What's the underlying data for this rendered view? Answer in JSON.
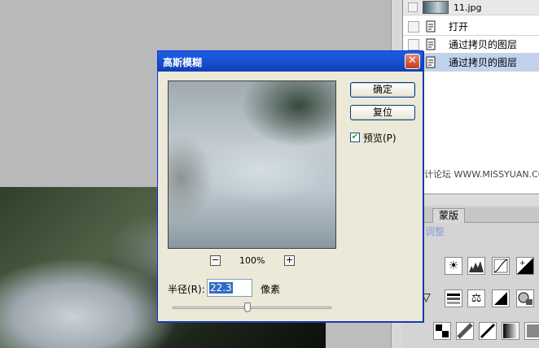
{
  "dialog": {
    "title": "高斯模糊",
    "close_label": "✕",
    "ok_label": "确定",
    "reset_label": "复位",
    "preview_checked": true,
    "preview_label": "预览(P)",
    "zoom_minus": "−",
    "zoom_level": "100%",
    "zoom_plus": "+",
    "radius_label": "半径(R):",
    "radius_value": "22.3",
    "radius_unit": "像素"
  },
  "history": {
    "snapshot_label": "11.jpg",
    "items": [
      {
        "label": "打开",
        "selected": false
      },
      {
        "label": "通过拷贝的图层",
        "selected": false
      },
      {
        "label": "通过拷贝的图层",
        "selected": true
      }
    ]
  },
  "adjustments": {
    "tab_label": "蒙版",
    "title": "调整"
  },
  "watermark": "思缘设计论坛  WWW.MISSYUAN.COM",
  "colors": {
    "titlebar": "#1850d1",
    "selection": "#c1d2ee",
    "dialog_bg": "#ece9d8"
  }
}
